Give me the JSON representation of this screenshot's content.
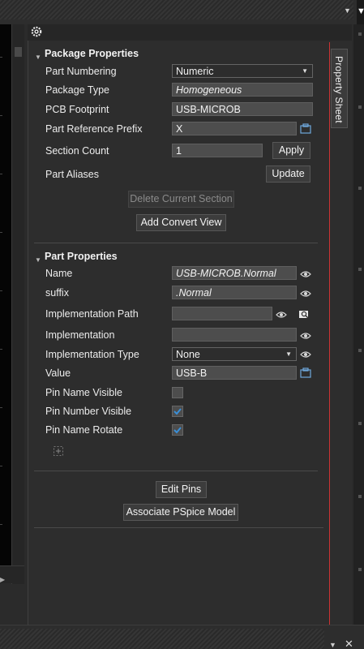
{
  "panel": {
    "tab_label": "Property Sheet"
  },
  "package_properties": {
    "header": "Package Properties",
    "part_numbering": {
      "label": "Part Numbering",
      "value": "Numeric"
    },
    "package_type": {
      "label": "Package Type",
      "value": "Homogeneous"
    },
    "pcb_footprint": {
      "label": "PCB Footprint",
      "value": "USB-MICROB"
    },
    "part_reference_prefix": {
      "label": "Part Reference Prefix",
      "value": "X"
    },
    "section_count": {
      "label": "Section Count",
      "value": "1",
      "apply_label": "Apply"
    },
    "part_aliases": {
      "label": "Part Aliases",
      "update_label": "Update"
    },
    "delete_section_label": "Delete Current Section",
    "add_convert_view_label": "Add Convert View"
  },
  "part_properties": {
    "header": "Part Properties",
    "name": {
      "label": "Name",
      "value": "USB-MICROB.Normal"
    },
    "suffix": {
      "label": "suffix",
      "value": ".Normal"
    },
    "implementation_path": {
      "label": "Implementation Path",
      "value": ""
    },
    "implementation": {
      "label": "Implementation",
      "value": ""
    },
    "implementation_type": {
      "label": "Implementation Type",
      "value": "None"
    },
    "value": {
      "label": "Value",
      "value": "USB-B"
    },
    "pin_name_visible": {
      "label": "Pin Name Visible",
      "checked": false
    },
    "pin_number_visible": {
      "label": "Pin Number Visible",
      "checked": true
    },
    "pin_name_rotate": {
      "label": "Pin Name Rotate",
      "checked": true
    }
  },
  "actions": {
    "edit_pins_label": "Edit Pins",
    "associate_pspice_label": "Associate PSpice Model"
  },
  "colors": {
    "accent_check": "#3a8fd8",
    "panel_bg": "#2d2d2d",
    "tab_border_red": "#cc3333"
  }
}
